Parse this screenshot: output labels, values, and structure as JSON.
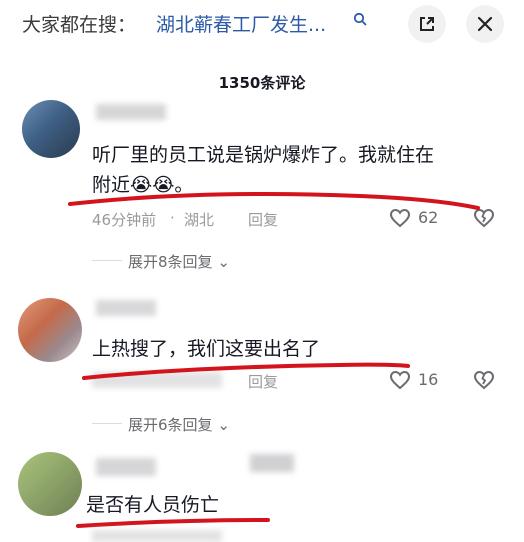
{
  "header": {
    "search_prefix": "大家都在搜：",
    "search_query": "湖北蕲春工厂发生...",
    "search_icon": "search-icon",
    "popout_icon": "popout-icon",
    "close_icon": "close-icon"
  },
  "comments_header": {
    "count_label": "1350条评论"
  },
  "comments": [
    {
      "text_line1": "听厂里的员工说是锅炉爆炸了。我就住在",
      "text_line2": "附近😭😭。",
      "time": "46分钟前",
      "location": "湖北",
      "reply_label": "回复",
      "likes": "62",
      "expand_label": "展开8条回复"
    },
    {
      "text_line1": "上热搜了，我们这要出名了",
      "reply_label": "回复",
      "likes": "16",
      "expand_label": "展开6条回复"
    },
    {
      "text_line1": "是否有人员伤亡"
    }
  ],
  "colors": {
    "accent_red": "#d4141c",
    "link_blue": "#2d5aa8",
    "muted": "#9a9a9e"
  }
}
